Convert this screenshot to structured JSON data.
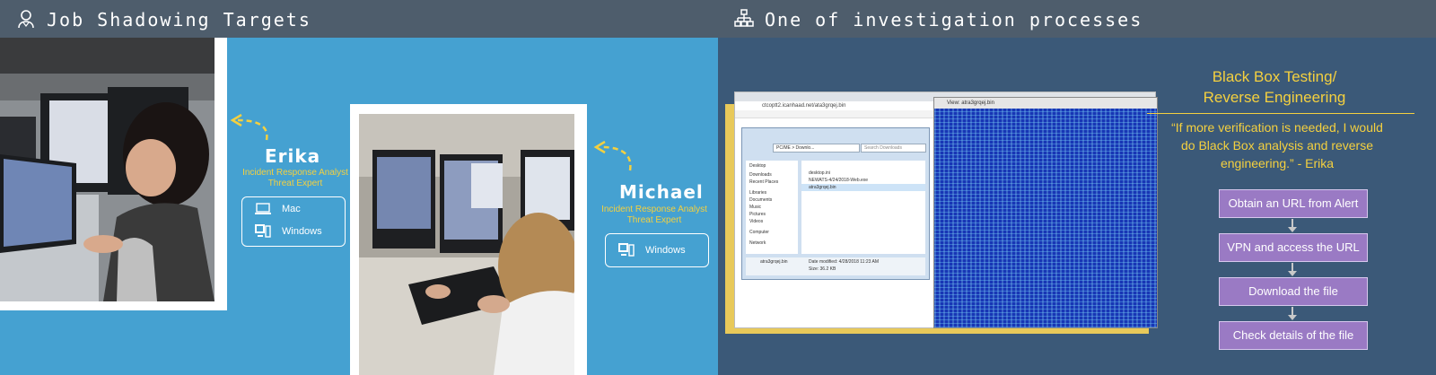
{
  "left": {
    "title": "Job Shadowing Targets",
    "erika": {
      "name": "Erika",
      "role_line1": "Incident Response Analyst",
      "role_line2": "Threat Expert",
      "os": [
        "Mac",
        "Windows"
      ]
    },
    "michael": {
      "name": "Michael",
      "role_line1": "Incident Response Analyst",
      "role_line2": "Threat Expert",
      "os": [
        "Windows"
      ]
    }
  },
  "right": {
    "title": "One of investigation processes",
    "bb_title_line1": "Black Box Testing/",
    "bb_title_line2": "Reverse Engineering",
    "quote": "“If more verification is needed, I would do Black Box analysis and reverse engineering.” - Erika",
    "steps": [
      "Obtain an URL from Alert",
      "VPN and access the URL",
      "Download the file",
      "Check details of the file"
    ],
    "screenshot": {
      "address": "ctcoptt2.icanhaad.net/ata3grqej.bin",
      "explorer_path": "PC/ME > Downlo...",
      "search_placeholder": "Search Downloads",
      "files": [
        "desktop.ini",
        "NEWATS-4/24/2018-Web.exe",
        "atra3grqej.bin"
      ],
      "sidebar": [
        "Desktop",
        "Downloads",
        "Recent Places",
        "Libraries",
        "Documents",
        "Music",
        "Pictures",
        "Videos",
        "Computer",
        "Network"
      ],
      "selected_file": "atra3grqej.bin",
      "date_modified": "Date modified: 4/28/2018 11:23 AM",
      "size": "Size: 36.2 KB",
      "hex_title": "View: atra3grqej.bin"
    }
  },
  "colors": {
    "left_bg": "#45a1d1",
    "right_bg": "#3b5978",
    "header_bg": "#4e5d6c",
    "accent_yellow": "#f4d03f",
    "step_purple": "#9a7ac4"
  }
}
